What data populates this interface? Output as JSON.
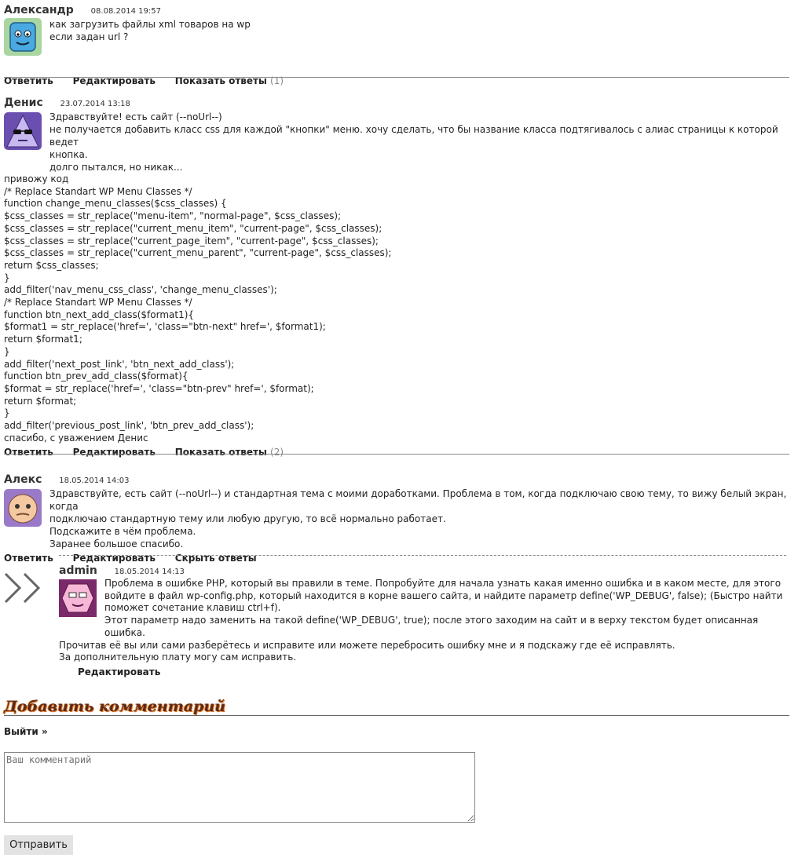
{
  "comments": [
    {
      "author": "Александр",
      "date": "08.08.2014 19:57",
      "lines": [
        "как загрузить файлы xml товаров на wp",
        "если задан url ?"
      ],
      "actions": {
        "reply": "Ответить",
        "edit": "Редактировать",
        "toggle": "Показать ответы",
        "count": "(1)"
      }
    },
    {
      "author": "Денис",
      "date": "23.07.2014 13:18",
      "lines_indented": [
        "Здравствуйте! есть сайт (--noUrl--)",
        "не получается добавить класс css для каждой \"кнопки\" меню. хочу сделать, что бы название класса подтягивалось с алиас страницы к которой ведет",
        "кнопка.",
        "долго пытался, но никак..."
      ],
      "lines_full": [
        "привожу код",
        "/* Replace Standart WP Menu Classes */",
        "function change_menu_classes($css_classes) {",
        "$css_classes = str_replace(\"menu-item\", \"normal-page\", $css_classes);",
        "$css_classes = str_replace(\"current_menu_item\", \"current-page\", $css_classes);",
        "$css_classes = str_replace(\"current_page_item\", \"current-page\", $css_classes);",
        "$css_classes = str_replace(\"current_menu_parent\", \"current-page\", $css_classes);",
        "return $css_classes;",
        "}",
        "add_filter('nav_menu_css_class', 'change_menu_classes');",
        "/* Replace Standart WP Menu Classes */",
        "function btn_next_add_class($format1){",
        "$format1 = str_replace('href=', 'class=\"btn-next\" href=', $format1);",
        "return $format1;",
        "}",
        "add_filter('next_post_link', 'btn_next_add_class');",
        "function btn_prev_add_class($format){",
        "$format = str_replace('href=', 'class=\"btn-prev\" href=', $format);",
        "return $format;",
        "}",
        "add_filter('previous_post_link', 'btn_prev_add_class');",
        "спасибо, с уважением Денис"
      ],
      "actions": {
        "reply": "Ответить",
        "edit": "Редактировать",
        "toggle": "Показать ответы",
        "count": "(2)"
      }
    },
    {
      "author": "Алекс",
      "date": "18.05.2014 14:03",
      "lines": [
        "Здравствуйте, есть сайт (--noUrl--) и стандартная тема с моими доработками. Проблема в том, когда подключаю свою тему, то вижу белый экран, когда",
        "подключаю стандартную тему или любую другую, то всё нормально работает.",
        "Подскажите в чём проблема.",
        "Заранее большое спасибо."
      ],
      "actions": {
        "reply": "Ответить",
        "edit": "Редактировать",
        "toggle": "Скрыть ответы"
      }
    }
  ],
  "reply": {
    "author": "admin",
    "date": "18.05.2014 14:13",
    "lines_indented": [
      "Проблема в ошибке PHP, который вы правили в теме. Попробуйте для начала узнать какая именно ошибка и в каком месте, для этого",
      "войдите в файл wp-config.php, который находится в корне вашего сайта, и найдите параметр define('WP_DEBUG', false); (Быстро найти",
      "поможет сочетание клавиш ctrl+f).",
      "Этот параметр надо заменить на такой define('WP_DEBUG', true); после этого заходим на сайт и в верху текстом будет описанная ошибка."
    ],
    "lines_full": [
      "Прочитав её вы или сами разберётесь и исправите или можете перебросить ошибку мне и я подскажу где её исправлять.",
      "За дополнительную плату могу сам исправить."
    ],
    "edit": "Редактировать"
  },
  "add_comment": {
    "title": "Добавить комментарий",
    "logout": "Выйти »",
    "placeholder": "Ваш комментарий",
    "submit": "Отправить"
  }
}
